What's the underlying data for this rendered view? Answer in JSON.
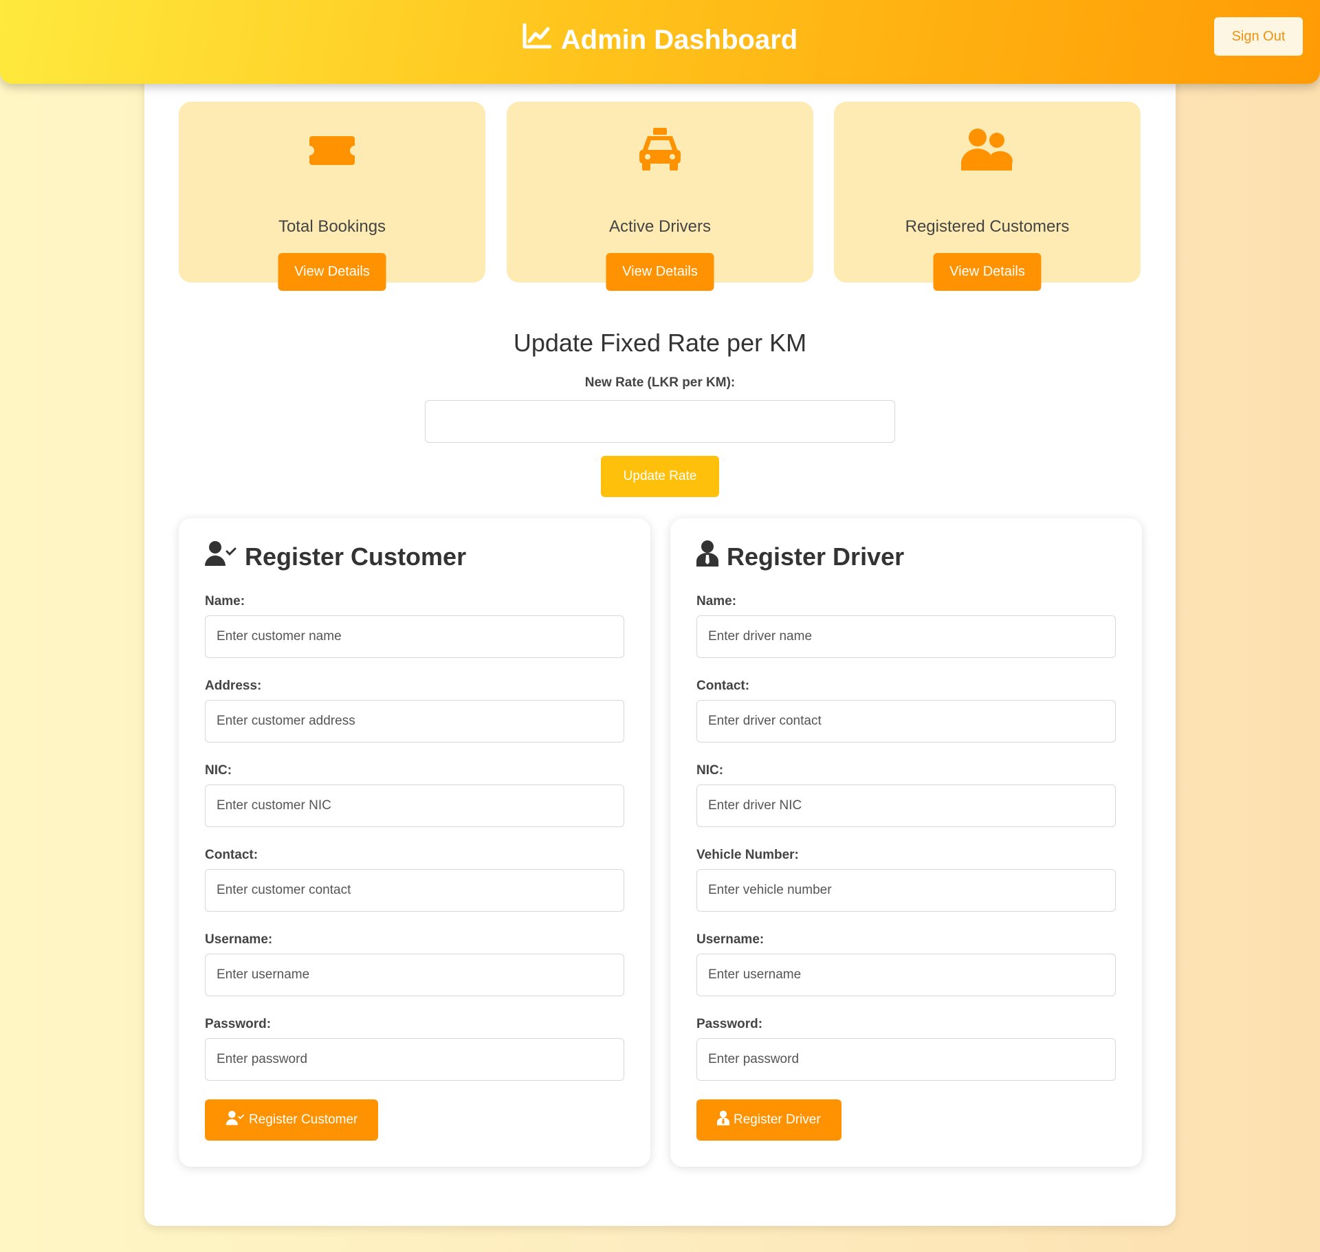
{
  "header": {
    "title": "Admin Dashboard",
    "title_icon": "chart-line-icon",
    "sign_out_label": "Sign Out"
  },
  "stats_cards": [
    {
      "icon": "ticket-icon",
      "label": "Total Bookings",
      "button_label": "View Details"
    },
    {
      "icon": "taxi-icon",
      "label": "Active Drivers",
      "button_label": "View Details"
    },
    {
      "icon": "users-icon",
      "label": "Registered Customers",
      "button_label": "View Details"
    }
  ],
  "rate_form": {
    "title": "Update Fixed Rate per KM",
    "label": "New Rate (LKR per KM):",
    "value": "",
    "button_label": "Update Rate"
  },
  "customer_form": {
    "title": "Register Customer",
    "title_icon": "user-check-icon",
    "fields": [
      {
        "label": "Name:",
        "placeholder": "Enter customer name"
      },
      {
        "label": "Address:",
        "placeholder": "Enter customer address"
      },
      {
        "label": "NIC:",
        "placeholder": "Enter customer NIC"
      },
      {
        "label": "Contact:",
        "placeholder": "Enter customer contact"
      },
      {
        "label": "Username:",
        "placeholder": "Enter username"
      },
      {
        "label": "Password:",
        "placeholder": "Enter password"
      }
    ],
    "button_label": "Register Customer"
  },
  "driver_form": {
    "title": "Register Driver",
    "title_icon": "user-tie-icon",
    "fields": [
      {
        "label": "Name:",
        "placeholder": "Enter driver name"
      },
      {
        "label": "Contact:",
        "placeholder": "Enter driver contact"
      },
      {
        "label": "NIC:",
        "placeholder": "Enter driver NIC"
      },
      {
        "label": "Vehicle Number:",
        "placeholder": "Enter vehicle number"
      },
      {
        "label": "Username:",
        "placeholder": "Enter username"
      },
      {
        "label": "Password:",
        "placeholder": "Enter password"
      }
    ],
    "button_label": "Register Driver"
  },
  "colors": {
    "accent": "#ff9200",
    "rate_button": "#ffc00c",
    "card_bg": "#feeab3",
    "header_start": "#ffe93d",
    "header_end": "#ff9b05"
  }
}
